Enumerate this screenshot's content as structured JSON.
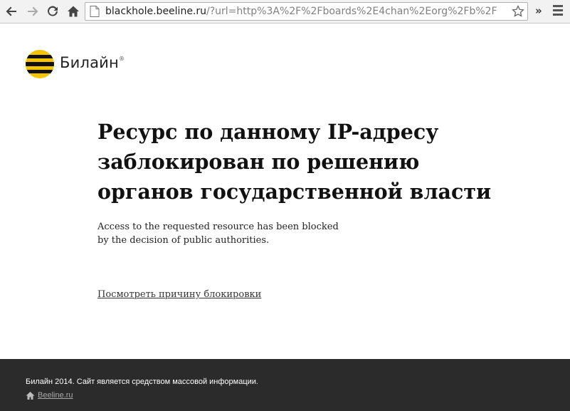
{
  "browser": {
    "url_host": "blackhole.beeline.ru",
    "url_rest": "/?url=http%3A%2F%2Fboards%2E4chan%2Eorg%2Fb%2F",
    "overflow_label": "»"
  },
  "page": {
    "brand_name": "Билайн",
    "brand_mark": "®",
    "headline_lines": [
      "Ресурс по данному IP-адресу",
      "заблокирован по решению",
      "органов государственной власти"
    ],
    "english_lines": [
      "Access to the requested resource has been blocked",
      "by the decision of public authorities."
    ],
    "reason_link": "Посмотреть причину блокировки"
  },
  "footer": {
    "copyright": "Билайн 2014. Сайт является средством массовой информации.",
    "site_link": "Beeline.ru"
  },
  "colors": {
    "brand_yellow": "#f5c400",
    "footer_bg": "#2b2b2b",
    "toolbar_bg": "#f2f2f2"
  }
}
